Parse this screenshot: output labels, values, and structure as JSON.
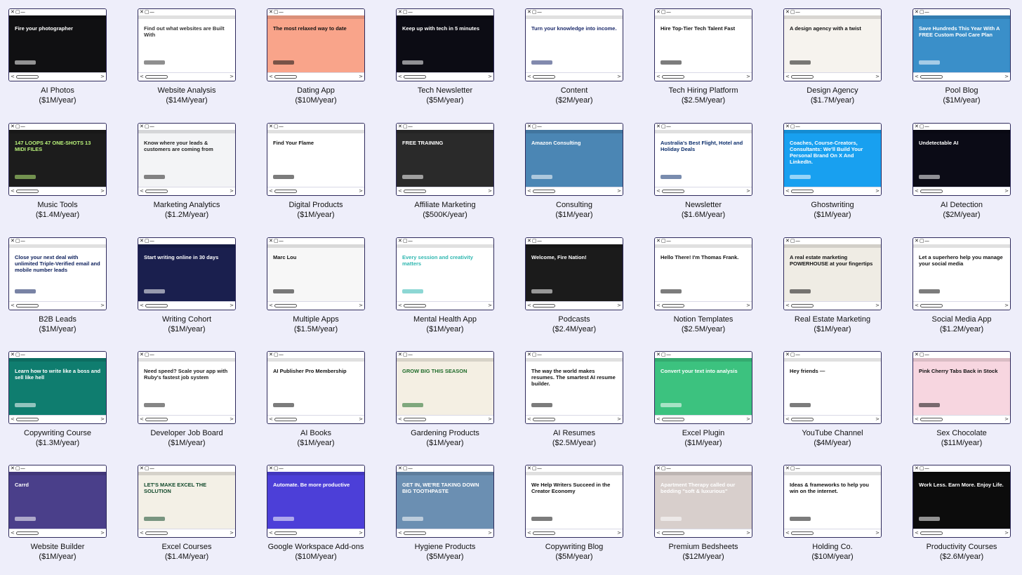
{
  "items": [
    {
      "name": "AI Photos",
      "revenue": "($1M/year)",
      "bg": "#101012",
      "fg": "#ffffff",
      "headline": "Fire your photographer"
    },
    {
      "name": "Website Analysis",
      "revenue": "($14M/year)",
      "bg": "#ffffff",
      "fg": "#333333",
      "headline": "Find out what websites are Built With"
    },
    {
      "name": "Dating App",
      "revenue": "($10M/year)",
      "bg": "#f9a48a",
      "fg": "#111111",
      "headline": "The most relaxed way to date"
    },
    {
      "name": "Tech Newsletter",
      "revenue": "($5M/year)",
      "bg": "#0c0c14",
      "fg": "#ffffff",
      "headline": "Keep up with tech in 5 minutes"
    },
    {
      "name": "Content",
      "revenue": "($2M/year)",
      "bg": "#ffffff",
      "fg": "#1b2a6b",
      "headline": "Turn your knowledge into income."
    },
    {
      "name": "Tech Hiring Platform",
      "revenue": "($2.5M/year)",
      "bg": "#ffffff",
      "fg": "#111111",
      "headline": "Hire Top-Tier Tech Talent Fast"
    },
    {
      "name": "Design Agency",
      "revenue": "($1.7M/year)",
      "bg": "#f6f3ee",
      "fg": "#111111",
      "headline": "A design agency with a twist"
    },
    {
      "name": "Pool Blog",
      "revenue": "($1M/year)",
      "bg": "#3a8fc9",
      "fg": "#ffffff",
      "headline": "Save Hundreds This Year With A FREE Custom Pool Care Plan"
    },
    {
      "name": "Music Tools",
      "revenue": "($1.4M/year)",
      "bg": "#1c1c1c",
      "fg": "#b9f27a",
      "headline": "147 LOOPS 47 ONE-SHOTS 13 MIDI FILES"
    },
    {
      "name": "Marketing Analytics",
      "revenue": "($1.2M/year)",
      "bg": "#f3f4f6",
      "fg": "#222222",
      "headline": "Know where your leads & customers are coming from"
    },
    {
      "name": "Digital Products",
      "revenue": "($1M/year)",
      "bg": "#ffffff",
      "fg": "#111111",
      "headline": "Find Your Flame"
    },
    {
      "name": "Affiliate Marketing",
      "revenue": "($500K/year)",
      "bg": "#2a2a2a",
      "fg": "#ffffff",
      "headline": "FREE TRAINING"
    },
    {
      "name": "Consulting",
      "revenue": "($1M/year)",
      "bg": "#4b86b4",
      "fg": "#ffffff",
      "headline": "Amazon Consulting"
    },
    {
      "name": "Newsletter",
      "revenue": "($1.6M/year)",
      "bg": "#ffffff",
      "fg": "#0b2d6b",
      "headline": "Australia's Best Flight, Hotel and Holiday Deals"
    },
    {
      "name": "Ghostwriting",
      "revenue": "($1M/year)",
      "bg": "#18a0f0",
      "fg": "#ffffff",
      "headline": "Coaches, Course-Creators, Consultants: We'll Build Your Personal Brand On X And LinkedIn."
    },
    {
      "name": "AI Detection",
      "revenue": "($2M/year)",
      "bg": "#0b0b16",
      "fg": "#ffffff",
      "headline": "Undetectable AI"
    },
    {
      "name": "B2B Leads",
      "revenue": "($1M/year)",
      "bg": "#ffffff",
      "fg": "#0b1e5b",
      "headline": "Close your next deal with unlimited Triple-Verified email and mobile number leads"
    },
    {
      "name": "Writing Cohort",
      "revenue": "($1M/year)",
      "bg": "#1a1f4e",
      "fg": "#ffffff",
      "headline": "Start writing online in 30 days"
    },
    {
      "name": "Multiple Apps",
      "revenue": "($1.5M/year)",
      "bg": "#f7f7f7",
      "fg": "#111111",
      "headline": "Marc Lou"
    },
    {
      "name": "Mental Health App",
      "revenue": "($1M/year)",
      "bg": "#ffffff",
      "fg": "#2fb7b0",
      "headline": "Every session and creativity matters"
    },
    {
      "name": "Podcasts",
      "revenue": "($2.4M/year)",
      "bg": "#1b1b1b",
      "fg": "#ffffff",
      "headline": "Welcome, Fire Nation!"
    },
    {
      "name": "Notion Templates",
      "revenue": "($2.5M/year)",
      "bg": "#ffffff",
      "fg": "#111111",
      "headline": "Hello There! I'm Thomas Frank."
    },
    {
      "name": "Real Estate Marketing",
      "revenue": "($1M/year)",
      "bg": "#efece4",
      "fg": "#111111",
      "headline": "A real estate marketing POWERHOUSE at your fingertips"
    },
    {
      "name": "Social Media App",
      "revenue": "($1.2M/year)",
      "bg": "#ffffff",
      "fg": "#111111",
      "headline": "Let a superhero help you manage your social media"
    },
    {
      "name": "Copywriting Course",
      "revenue": "($1.3M/year)",
      "bg": "#0f7d6f",
      "fg": "#ffffff",
      "headline": "Learn how to write like a boss and sell like hell"
    },
    {
      "name": "Developer Job Board",
      "revenue": "($1M/year)",
      "bg": "#ffffff",
      "fg": "#222222",
      "headline": "Need speed? Scale your app with Ruby's fastest job system"
    },
    {
      "name": "AI Books",
      "revenue": "($1M/year)",
      "bg": "#ffffff",
      "fg": "#111111",
      "headline": "AI Publisher Pro Membership"
    },
    {
      "name": "Gardening Products",
      "revenue": "($1M/year)",
      "bg": "#f4efe3",
      "fg": "#1f6b2a",
      "headline": "GROW BIG THIS SEASON"
    },
    {
      "name": "AI Resumes",
      "revenue": "($2.5M/year)",
      "bg": "#ffffff",
      "fg": "#111111",
      "headline": "The way the world makes resumes. The smartest AI resume builder."
    },
    {
      "name": "Excel Plugin",
      "revenue": "($1M/year)",
      "bg": "#3cc27f",
      "fg": "#ffffff",
      "headline": "Convert your text into analysis"
    },
    {
      "name": "YouTube Channel",
      "revenue": "($4M/year)",
      "bg": "#ffffff",
      "fg": "#111111",
      "headline": "Hey friends —"
    },
    {
      "name": "Sex Chocolate",
      "revenue": "($11M/year)",
      "bg": "#f7d6e0",
      "fg": "#111111",
      "headline": "Pink Cherry Tabs Back in Stock"
    },
    {
      "name": "Website Builder",
      "revenue": "($1M/year)",
      "bg": "#4a3f8a",
      "fg": "#ffffff",
      "headline": "Carrd"
    },
    {
      "name": "Excel Courses",
      "revenue": "($1.4M/year)",
      "bg": "#f3f0e6",
      "fg": "#124a2c",
      "headline": "LET'S MAKE EXCEL THE SOLUTION"
    },
    {
      "name": "Google Workspace Add-ons",
      "revenue": "($10M/year)",
      "bg": "#4c3fd8",
      "fg": "#ffffff",
      "headline": "Automate. Be more productive"
    },
    {
      "name": "Hygiene Products",
      "revenue": "($5M/year)",
      "bg": "#6b8fb2",
      "fg": "#ffffff",
      "headline": "GET IN, WE'RE TAKING DOWN BIG TOOTHPASTE"
    },
    {
      "name": "Copywriting Blog",
      "revenue": "($5M/year)",
      "bg": "#ffffff",
      "fg": "#111111",
      "headline": "We Help Writers Succeed in the Creator Economy"
    },
    {
      "name": "Premium Bedsheets",
      "revenue": "($12M/year)",
      "bg": "#d8cfcc",
      "fg": "#ffffff",
      "headline": "Apartment Therapy called our bedding \"soft & luxurious\""
    },
    {
      "name": "Holding Co.",
      "revenue": "($10M/year)",
      "bg": "#ffffff",
      "fg": "#111111",
      "headline": "Ideas & frameworks to help you win on the internet."
    },
    {
      "name": "Productivity Courses",
      "revenue": "($2.6M/year)",
      "bg": "#0c0c0c",
      "fg": "#ffffff",
      "headline": "Work Less. Earn More. Enjoy Life."
    }
  ]
}
